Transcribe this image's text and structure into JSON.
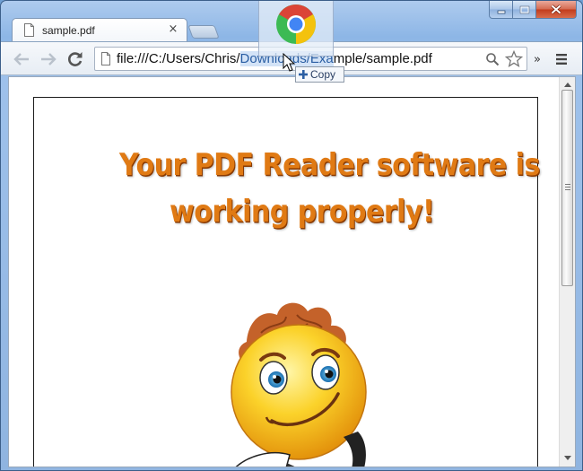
{
  "window": {
    "caption_buttons": [
      "minimize",
      "maximize",
      "close"
    ]
  },
  "tab": {
    "title": "sample.pdf",
    "close_glyph": "×"
  },
  "toolbar": {
    "url_prefix": "file:///C:/Users/Chris/",
    "url_selected": "Downloads/Exa",
    "url_suffix": "mple/sample.pdf",
    "overflow_glyph": "»"
  },
  "drag": {
    "copy_label": "Copy"
  },
  "document": {
    "headline_line1": "Your PDF Reader software is",
    "headline_line2": "working properly!"
  },
  "colors": {
    "headline": "#e07a14",
    "chrome_red": "#db4437",
    "chrome_yellow": "#f4c20d",
    "chrome_green": "#3cba54",
    "chrome_blue": "#4285f4"
  }
}
